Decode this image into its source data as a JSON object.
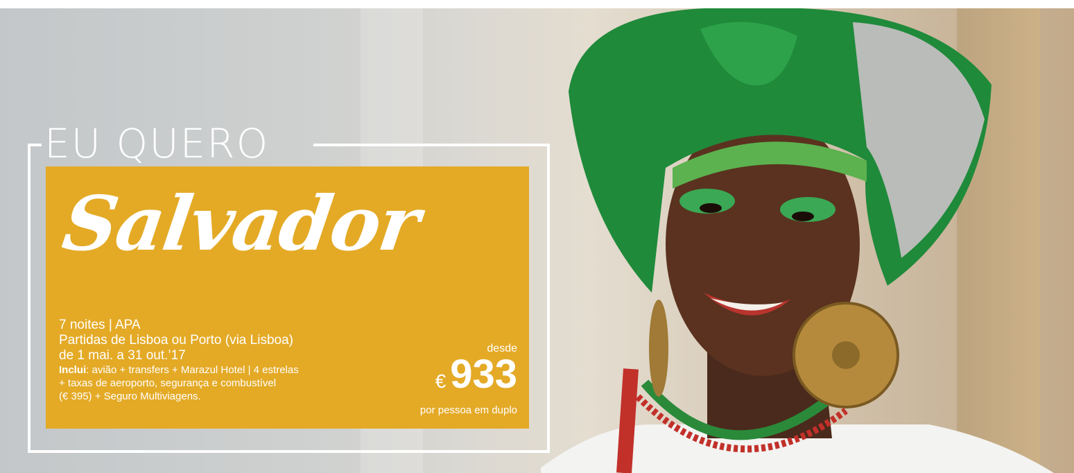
{
  "banner": {
    "title": "EU QUERO",
    "destination": "Salvador",
    "info": {
      "line1": "7 noites | APA",
      "line2": "Partidas de Lisboa ou Porto (via Lisboa)",
      "line3": "de 1 mai. a 31 out.’17",
      "includes_label": "Inclui",
      "includes_line1": ": avião + transfers + Marazul Hotel | 4 estrelas",
      "includes_line2": "+ taxas de aeroporto, segurança e combustível",
      "includes_line3": "(€ 395) + Seguro Multiviagens."
    },
    "price": {
      "desde": "desde",
      "currency": "€",
      "amount": "933",
      "note": "por pessoa em duplo"
    }
  },
  "colors": {
    "panel": "#e4aa26",
    "text": "#ffffff",
    "headscarf": "#1f8a3a"
  }
}
